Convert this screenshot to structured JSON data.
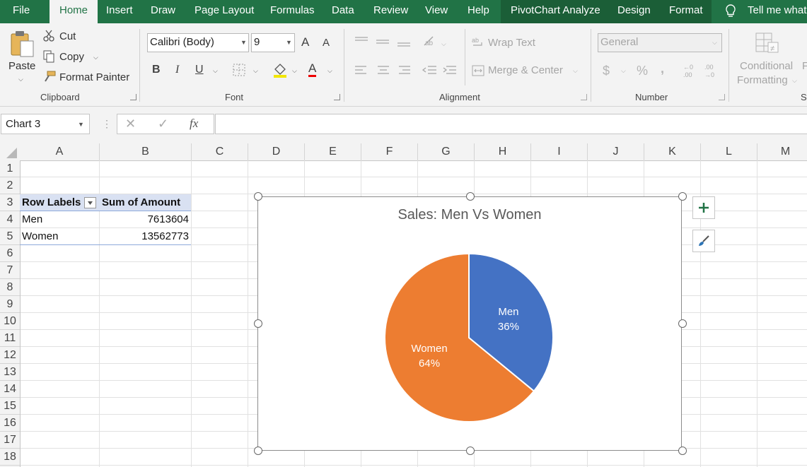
{
  "tabs": {
    "file": "File",
    "home": "Home",
    "insert": "Insert",
    "draw": "Draw",
    "page_layout": "Page Layout",
    "formulas": "Formulas",
    "data": "Data",
    "review": "Review",
    "view": "View",
    "help": "Help",
    "pivotchart_analyze": "PivotChart Analyze",
    "design": "Design",
    "format": "Format",
    "tell_me": "Tell me what"
  },
  "clipboard": {
    "paste": "Paste",
    "cut": "Cut",
    "copy": "Copy",
    "format_painter": "Format Painter",
    "label": "Clipboard"
  },
  "font": {
    "name": "Calibri (Body)",
    "size": "9",
    "label": "Font",
    "bold": "B",
    "italic": "I",
    "underline": "U",
    "grow": "A",
    "shrink": "A",
    "color": "A"
  },
  "alignment": {
    "wrap_text": "Wrap Text",
    "merge_center": "Merge & Center",
    "label": "Alignment"
  },
  "number": {
    "format": "General",
    "currency": "$",
    "percent": "%",
    "comma": ",",
    "label": "Number"
  },
  "styles": {
    "conditional": "Conditional",
    "formatting": "Formatting",
    "next": "F",
    "label": "St"
  },
  "formula_bar": {
    "name_box": "Chart 3",
    "cancel": "✕",
    "enter": "✓",
    "fx": "fx",
    "value": ""
  },
  "columns": [
    "A",
    "B",
    "C",
    "D",
    "E",
    "F",
    "G",
    "H",
    "I",
    "J",
    "K",
    "L",
    "M"
  ],
  "rows": [
    "1",
    "2",
    "3",
    "4",
    "5",
    "6",
    "7",
    "8",
    "9",
    "10",
    "11",
    "12",
    "13",
    "14",
    "15",
    "16",
    "17",
    "18"
  ],
  "pivot": {
    "header_labels": "Row Labels",
    "header_sum": "Sum of Amount",
    "rows": [
      {
        "label": "Men",
        "value": "7613604"
      },
      {
        "label": "Women",
        "value": "13562773"
      }
    ]
  },
  "colors": {
    "men": "#4472c4",
    "women": "#ed7d31",
    "ribbon_green": "#217346"
  },
  "chart_data": {
    "type": "pie",
    "title": "Sales: Men Vs Women",
    "categories": [
      "Men",
      "Women"
    ],
    "values": [
      7613604,
      13562773
    ],
    "data_labels": [
      "36%",
      "64%"
    ],
    "colors": [
      "#4472c4",
      "#ed7d31"
    ]
  }
}
